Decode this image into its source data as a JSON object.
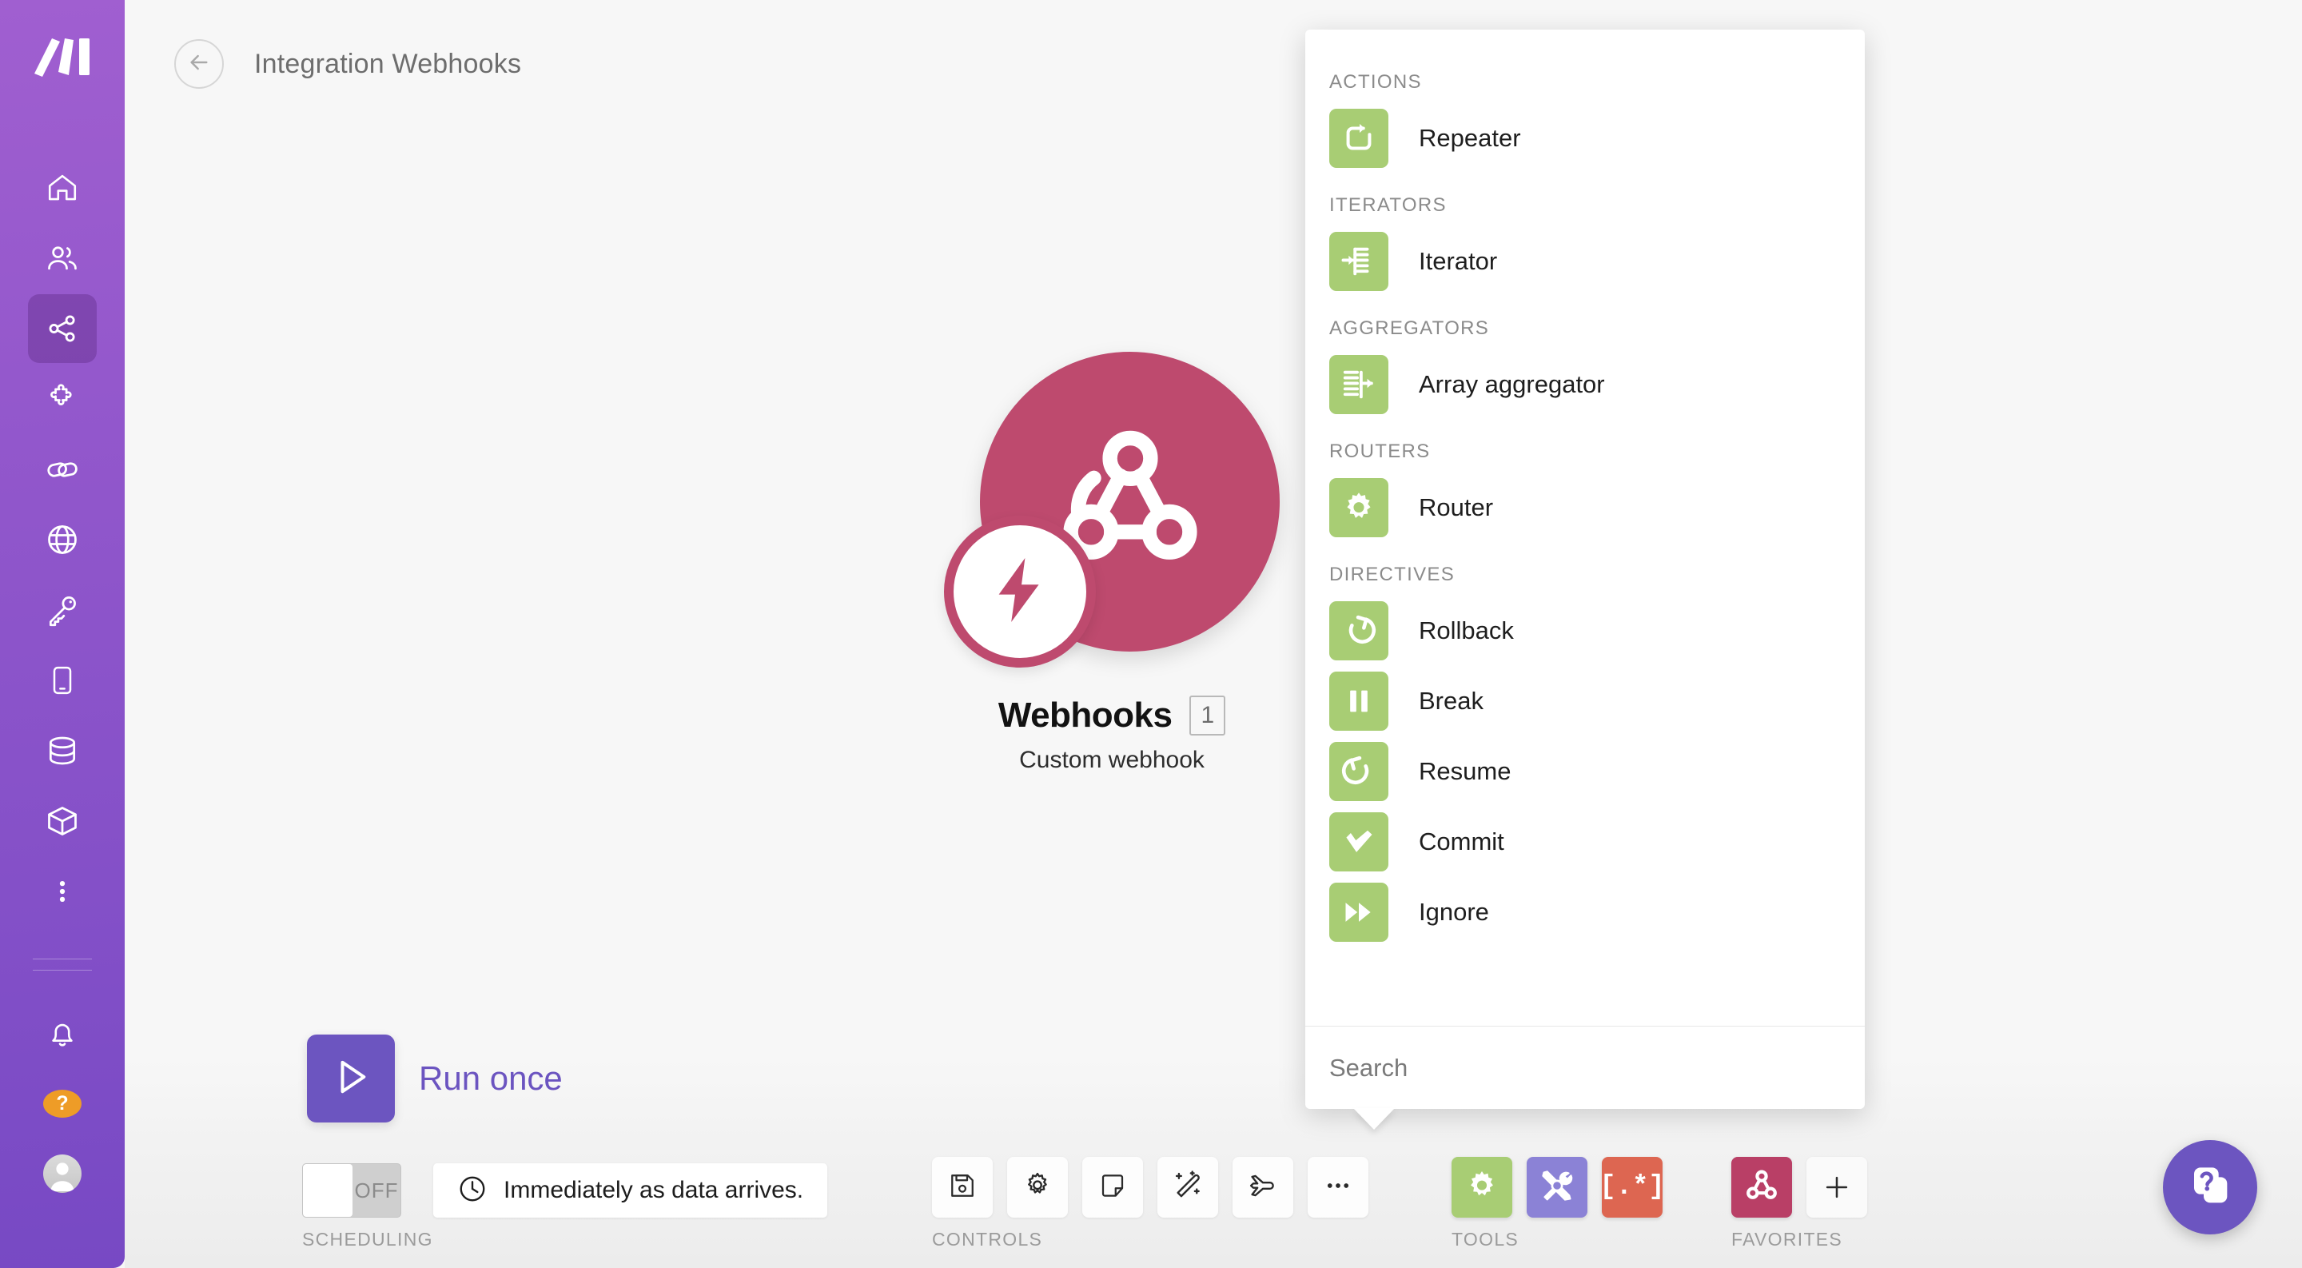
{
  "app": {
    "brand": "make-logo",
    "background_color": "#f7f7f7",
    "accent_purple": "#6c55c0",
    "sidebar_gradient_from": "#a05fd0",
    "sidebar_gradient_to": "#7749c4",
    "tool_green": "#a8cd74",
    "tool_purple": "#8b82d6",
    "tool_orange": "#dd6651",
    "webhook_crimson": "#be4a6e"
  },
  "sidebar": {
    "logo_name": "make-logo",
    "items": [
      {
        "icon": "home-icon",
        "name": "sidebar-item-home",
        "active": false
      },
      {
        "icon": "team-icon",
        "name": "sidebar-item-team",
        "active": false
      },
      {
        "icon": "scenarios-icon",
        "name": "sidebar-item-scenarios",
        "active": true
      },
      {
        "icon": "templates-puzzle-icon",
        "name": "sidebar-item-templates",
        "active": false
      },
      {
        "icon": "connections-link-icon",
        "name": "sidebar-item-connections",
        "active": false
      },
      {
        "icon": "webhooks-globe-icon",
        "name": "sidebar-item-webhooks",
        "active": false
      },
      {
        "icon": "keys-icon",
        "name": "sidebar-item-keys",
        "active": false
      },
      {
        "icon": "devices-icon",
        "name": "sidebar-item-devices",
        "active": false
      },
      {
        "icon": "data-stores-icon",
        "name": "sidebar-item-data-stores",
        "active": false
      },
      {
        "icon": "data-structures-box-icon",
        "name": "sidebar-item-data-structures",
        "active": false
      },
      {
        "icon": "more-vertical-icon",
        "name": "sidebar-item-more",
        "active": false
      }
    ],
    "bottom": {
      "notifications_icon": "bell-icon",
      "help_label": "?",
      "avatar_name": "user-avatar"
    }
  },
  "header": {
    "back_icon": "arrow-left-icon",
    "title": "Integration Webhooks"
  },
  "canvas": {
    "module": {
      "name": "Webhooks",
      "sequence": "1",
      "subtitle": "Custom webhook",
      "icon": "webhook-icon",
      "badge_icon": "lightning-bolt-icon"
    }
  },
  "tools_panel": {
    "groups": [
      {
        "label": "ACTIONS",
        "items": [
          {
            "label": "Repeater",
            "icon": "repeater-icon"
          }
        ]
      },
      {
        "label": "ITERATORS",
        "items": [
          {
            "label": "Iterator",
            "icon": "iterator-icon"
          }
        ]
      },
      {
        "label": "AGGREGATORS",
        "items": [
          {
            "label": "Array aggregator",
            "icon": "array-aggregator-icon"
          }
        ]
      },
      {
        "label": "ROUTERS",
        "items": [
          {
            "label": "Router",
            "icon": "router-gear-icon"
          }
        ]
      },
      {
        "label": "DIRECTIVES",
        "items": [
          {
            "label": "Rollback",
            "icon": "rollback-icon"
          },
          {
            "label": "Break",
            "icon": "break-pause-icon"
          },
          {
            "label": "Resume",
            "icon": "resume-icon"
          },
          {
            "label": "Commit",
            "icon": "commit-check-icon"
          },
          {
            "label": "Ignore",
            "icon": "ignore-fastforward-icon"
          }
        ]
      }
    ],
    "search": {
      "value": "",
      "placeholder": "Search"
    }
  },
  "bottom_bar": {
    "run_once": {
      "label": "Run once",
      "icon": "play-icon"
    },
    "scheduling": {
      "caption": "SCHEDULING",
      "toggle_state": "OFF",
      "chip_text": "Immediately as data arrives.",
      "chip_icon": "clock-icon"
    },
    "controls": {
      "caption": "CONTROLS",
      "buttons": [
        {
          "name": "save-button",
          "icon": "floppy-save-icon"
        },
        {
          "name": "settings-button",
          "icon": "gear-icon"
        },
        {
          "name": "notes-button",
          "icon": "note-icon"
        },
        {
          "name": "auto-align-button",
          "icon": "magic-wand-icon"
        },
        {
          "name": "explorer-button",
          "icon": "airplane-icon"
        },
        {
          "name": "more-options-button",
          "icon": "ellipsis-icon"
        }
      ]
    },
    "tools": {
      "caption": "TOOLS",
      "buttons": [
        {
          "name": "flow-control-button",
          "icon": "gear-icon",
          "color": "#a8cd74",
          "active": true
        },
        {
          "name": "tools-button",
          "icon": "screwdriver-wrench-icon",
          "color": "#8b82d6",
          "active": false
        },
        {
          "name": "text-parser-button",
          "icon": "regex-icon",
          "color": "#dd6651",
          "active": false,
          "glyph": "[.*]"
        }
      ]
    },
    "favorites": {
      "caption": "FAVORITES",
      "buttons": [
        {
          "name": "favorite-webhooks-button",
          "icon": "webhook-icon",
          "color": "#b93f66"
        }
      ],
      "add_label": "+",
      "add_name": "add-favorite-button"
    }
  },
  "help_widget": {
    "name": "help-widget",
    "icon": "help-cards-icon"
  }
}
